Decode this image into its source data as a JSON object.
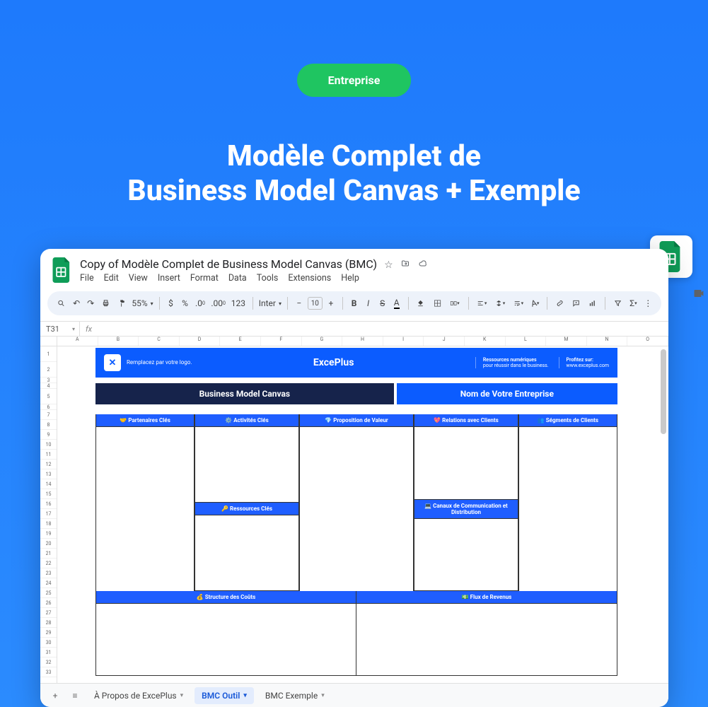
{
  "hero": {
    "pill": "Entreprise",
    "title_line1": "Modèle Complet de",
    "title_line2": "Business Model Canvas + Exemple"
  },
  "doc": {
    "title": "Copy of Modèle Complet de Business Model Canvas (BMC)",
    "menu": {
      "file": "File",
      "edit": "Edit",
      "view": "View",
      "insert": "Insert",
      "format": "Format",
      "data": "Data",
      "tools": "Tools",
      "extensions": "Extensions",
      "help": "Help"
    }
  },
  "toolbar": {
    "zoom": "55%",
    "font": "Inter",
    "font_size": "10",
    "number_ex": "123",
    "currency": "$",
    "percent": "%"
  },
  "formula": {
    "cell": "T31",
    "fx": "fx"
  },
  "columns": [
    "A",
    "B",
    "C",
    "D",
    "E",
    "F",
    "G",
    "H",
    "I",
    "J",
    "K",
    "L",
    "M",
    "N",
    "O"
  ],
  "rows": [
    "1",
    "2",
    "3",
    "4",
    "5",
    "6",
    "7",
    "8",
    "9",
    "10",
    "11",
    "12",
    "13",
    "14",
    "15",
    "16",
    "17",
    "18",
    "19",
    "20",
    "21",
    "22",
    "23",
    "24",
    "25",
    "26",
    "27",
    "28",
    "29",
    "30",
    "31",
    "32",
    "33"
  ],
  "banner": {
    "logo_text": "Remplacez par votre logo.",
    "brand": "ExcePlus",
    "tag1_title": "Ressources numériques",
    "tag1_sub": "pour réussir dans le business.",
    "tag2_title": "Profitez sur:",
    "tag2_sub": "www.exceplus.com"
  },
  "subhead": {
    "left": "Business Model Canvas",
    "right": "Nom de Votre Entreprise"
  },
  "bmc": {
    "partners": "🤝 Partenaires Clés",
    "activities": "⚙️ Activités Clés",
    "resources": "🔑 Ressources Clés",
    "value": "💎 Proposition de Valeur",
    "relations": "💖 Relations avec Clients",
    "channels": "💻 Canaux de Communication et Distribution",
    "segments": "👥 Ségments de Clients",
    "costs": "💰 Structure des Coûts",
    "revenue": "💵 Flux de Revenus"
  },
  "tabs": {
    "about": "À Propos de ExcePlus",
    "tool": "BMC Outil",
    "example": "BMC Exemple"
  }
}
